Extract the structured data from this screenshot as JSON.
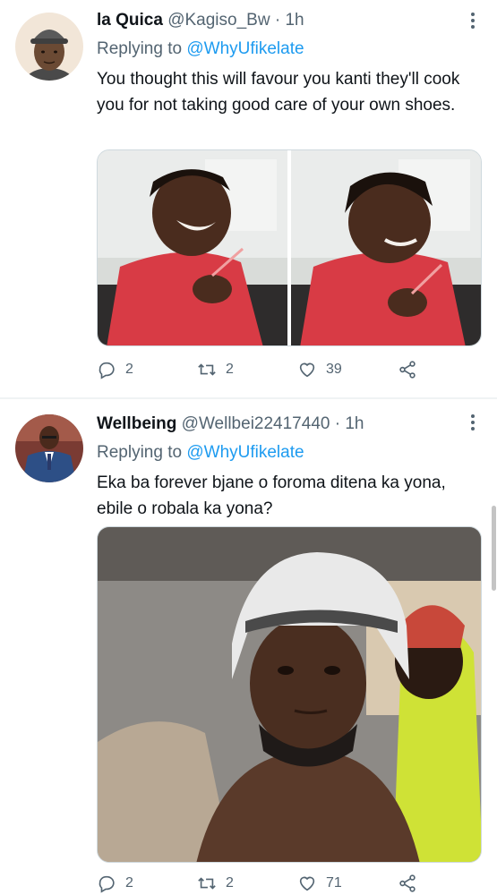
{
  "tweets": [
    {
      "name": "la Quica",
      "handle": "@Kagiso_Bw",
      "separator": "·",
      "time": "1h",
      "replying_prefix": "Replying to",
      "replying_to": "@WhyUfikelate",
      "text": "You thought this will favour you kanti they'll cook you for not taking good care of your own shoes.",
      "replies": "2",
      "retweets": "2",
      "likes": "39"
    },
    {
      "name": "Wellbeing",
      "handle": "@Wellbei22417440",
      "separator": "·",
      "time": "1h",
      "replying_prefix": "Replying to",
      "replying_to": "@WhyUfikelate",
      "text": "Eka ba forever bjane o foroma ditena ka yona, ebile o robala ka yona?",
      "replies": "2",
      "retweets": "2",
      "likes": "71"
    }
  ],
  "icons": {
    "more": "more-vertical-icon",
    "reply": "reply-bubble-icon",
    "retweet": "retweet-icon",
    "like": "heart-icon",
    "share": "share-icon"
  },
  "colors": {
    "text": "#0f1419",
    "muted": "#536471",
    "link": "#1d9bf0",
    "divider": "#eff3f4"
  }
}
